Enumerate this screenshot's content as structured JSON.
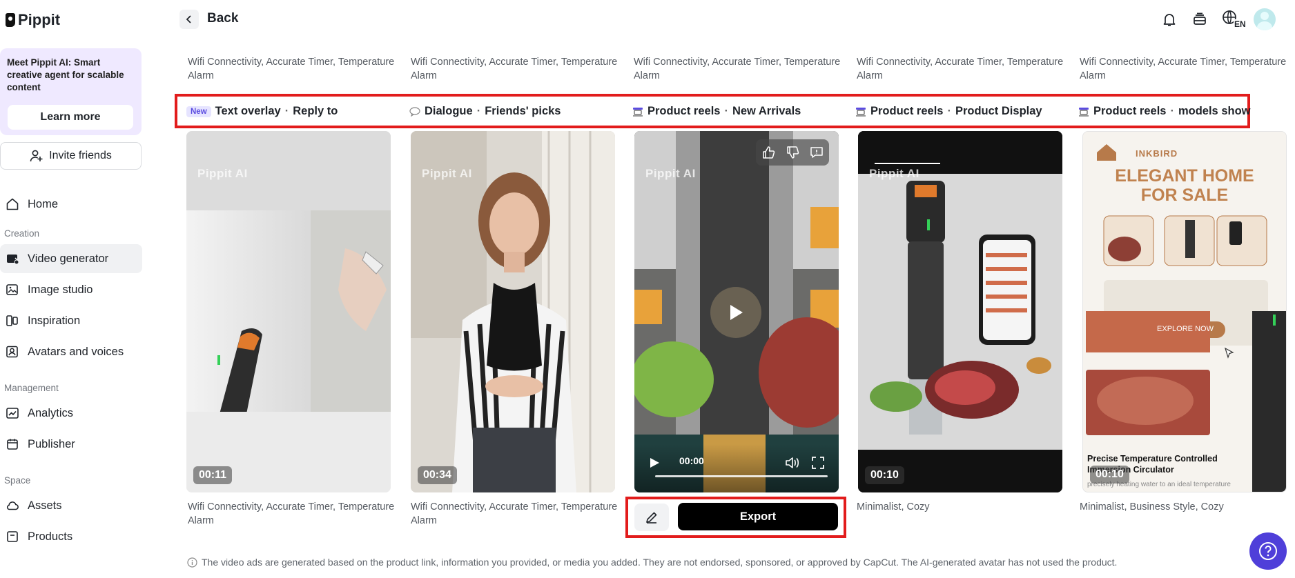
{
  "app": {
    "name": "Pippit"
  },
  "sidebar": {
    "promo": {
      "text": "Meet Pippit AI: Smart creative agent for scalable content",
      "button": "Learn more"
    },
    "invite": "Invite friends",
    "home": "Home",
    "sections": {
      "creation": "Creation",
      "management": "Management",
      "space": "Space"
    },
    "items": {
      "video_generator": "Video generator",
      "image_studio": "Image studio",
      "inspiration": "Inspiration",
      "avatars": "Avatars and voices",
      "analytics": "Analytics",
      "publisher": "Publisher",
      "assets": "Assets",
      "products": "Products"
    }
  },
  "topbar": {
    "back": "Back",
    "lang": "EN"
  },
  "top_captions": [
    "Wifi Connectivity, Accurate Timer, Temperature Alarm",
    "Wifi Connectivity, Accurate Timer, Temperature Alarm",
    "Wifi Connectivity, Accurate Timer, Temperature Alarm",
    "Wifi Connectivity, Accurate Timer, Temperature Alarm",
    "Wifi Connectivity, Accurate Timer, Temperature Alarm"
  ],
  "tags": [
    {
      "badge": "New",
      "a": "Text overlay",
      "b": "Reply to"
    },
    {
      "a": "Dialogue",
      "b": "Friends' picks"
    },
    {
      "a": "Product reels",
      "b": "New Arrivals"
    },
    {
      "a": "Product reels",
      "b": "Product Display"
    },
    {
      "a": "Product reels",
      "b": "models show"
    }
  ],
  "separator": "·",
  "cards": [
    {
      "duration": "00:11",
      "watermark": "Pippit AI"
    },
    {
      "duration": "00:34",
      "watermark": "Pippit AI"
    },
    {
      "time": "00:00",
      "watermark": "Pippit AI"
    },
    {
      "duration": "00:10",
      "watermark": "Pippit AI"
    },
    {
      "duration": "00:10",
      "brand": "INKBIRD",
      "headline_1": "ELEGANT HOME",
      "headline_2": "FOR SALE",
      "cta": "EXPLORE NOW",
      "product_title": "Precise Temperature Controlled",
      "product_title_2": "Immersion Circulator",
      "product_sub": "precisely heating water to an ideal temperature"
    }
  ],
  "bottom_captions": [
    "Wifi Connectivity, Accurate Timer, Temperature Alarm",
    "Wifi Connectivity, Accurate Timer, Temperature Alarm",
    "",
    "Minimalist, Cozy",
    "Minimalist, Business Style, Cozy"
  ],
  "actions": {
    "export": "Export"
  },
  "footnote": "The video ads are generated based on the product link, information you provided, or media you added. They are not endorsed, sponsored, or approved by CapCut. The AI-generated avatar has not used the product.",
  "colors": {
    "highlight": "#e21c1c",
    "promo_bg": "#efe9ff",
    "help": "#4f3fd9"
  }
}
